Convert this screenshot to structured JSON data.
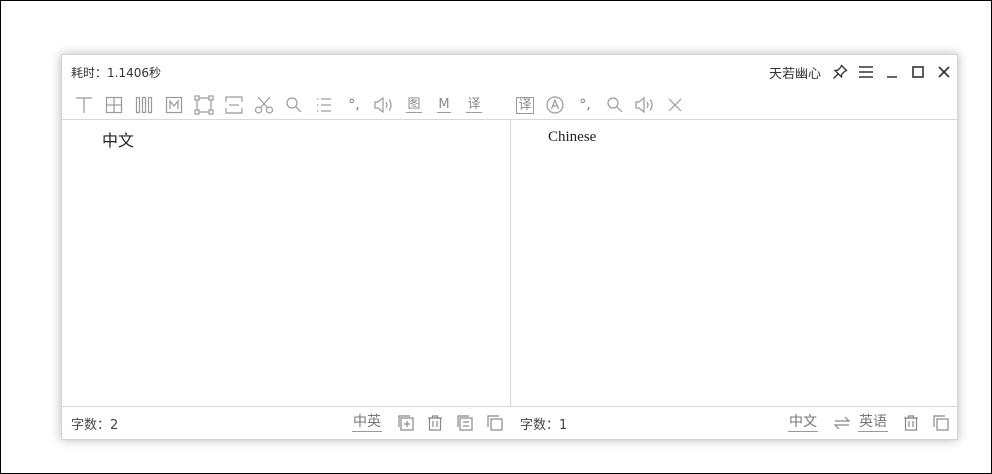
{
  "title_bar": {
    "elapsed": "耗时：1.1406秒",
    "user_name": "天若幽心"
  },
  "toolbar": {
    "image_label": "图",
    "mark_label": "M",
    "translate_label": "译",
    "translate2_label": "译",
    "punct_left": "°,",
    "punct_right": "°,"
  },
  "source": {
    "text": "中文",
    "count_label": "字数：2",
    "lang_pair": "中英"
  },
  "target": {
    "text": "Chinese",
    "count_label": "字数：1",
    "from_lang": "中文",
    "to_lang": "英语"
  },
  "colors": {
    "icon": "#9a9a9a",
    "text": "#333333",
    "border": "#d8d8d8"
  }
}
